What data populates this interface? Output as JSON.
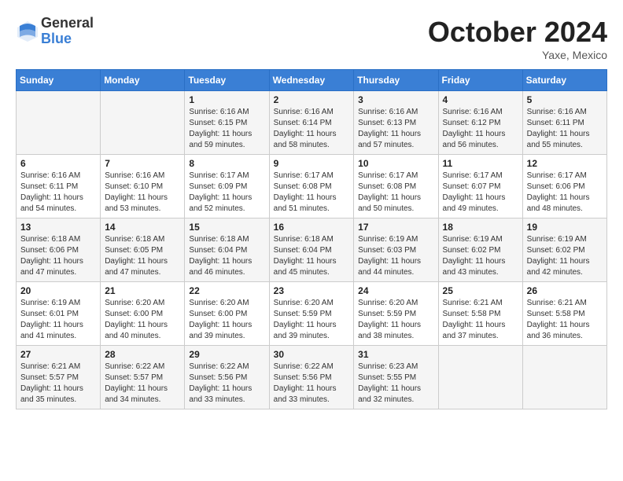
{
  "header": {
    "logo_general": "General",
    "logo_blue": "Blue",
    "month_title": "October 2024",
    "location": "Yaxe, Mexico"
  },
  "days_of_week": [
    "Sunday",
    "Monday",
    "Tuesday",
    "Wednesday",
    "Thursday",
    "Friday",
    "Saturday"
  ],
  "weeks": [
    [
      {
        "day": "",
        "info": ""
      },
      {
        "day": "",
        "info": ""
      },
      {
        "day": "1",
        "info": "Sunrise: 6:16 AM\nSunset: 6:15 PM\nDaylight: 11 hours and 59 minutes."
      },
      {
        "day": "2",
        "info": "Sunrise: 6:16 AM\nSunset: 6:14 PM\nDaylight: 11 hours and 58 minutes."
      },
      {
        "day": "3",
        "info": "Sunrise: 6:16 AM\nSunset: 6:13 PM\nDaylight: 11 hours and 57 minutes."
      },
      {
        "day": "4",
        "info": "Sunrise: 6:16 AM\nSunset: 6:12 PM\nDaylight: 11 hours and 56 minutes."
      },
      {
        "day": "5",
        "info": "Sunrise: 6:16 AM\nSunset: 6:11 PM\nDaylight: 11 hours and 55 minutes."
      }
    ],
    [
      {
        "day": "6",
        "info": "Sunrise: 6:16 AM\nSunset: 6:11 PM\nDaylight: 11 hours and 54 minutes."
      },
      {
        "day": "7",
        "info": "Sunrise: 6:16 AM\nSunset: 6:10 PM\nDaylight: 11 hours and 53 minutes."
      },
      {
        "day": "8",
        "info": "Sunrise: 6:17 AM\nSunset: 6:09 PM\nDaylight: 11 hours and 52 minutes."
      },
      {
        "day": "9",
        "info": "Sunrise: 6:17 AM\nSunset: 6:08 PM\nDaylight: 11 hours and 51 minutes."
      },
      {
        "day": "10",
        "info": "Sunrise: 6:17 AM\nSunset: 6:08 PM\nDaylight: 11 hours and 50 minutes."
      },
      {
        "day": "11",
        "info": "Sunrise: 6:17 AM\nSunset: 6:07 PM\nDaylight: 11 hours and 49 minutes."
      },
      {
        "day": "12",
        "info": "Sunrise: 6:17 AM\nSunset: 6:06 PM\nDaylight: 11 hours and 48 minutes."
      }
    ],
    [
      {
        "day": "13",
        "info": "Sunrise: 6:18 AM\nSunset: 6:06 PM\nDaylight: 11 hours and 47 minutes."
      },
      {
        "day": "14",
        "info": "Sunrise: 6:18 AM\nSunset: 6:05 PM\nDaylight: 11 hours and 47 minutes."
      },
      {
        "day": "15",
        "info": "Sunrise: 6:18 AM\nSunset: 6:04 PM\nDaylight: 11 hours and 46 minutes."
      },
      {
        "day": "16",
        "info": "Sunrise: 6:18 AM\nSunset: 6:04 PM\nDaylight: 11 hours and 45 minutes."
      },
      {
        "day": "17",
        "info": "Sunrise: 6:19 AM\nSunset: 6:03 PM\nDaylight: 11 hours and 44 minutes."
      },
      {
        "day": "18",
        "info": "Sunrise: 6:19 AM\nSunset: 6:02 PM\nDaylight: 11 hours and 43 minutes."
      },
      {
        "day": "19",
        "info": "Sunrise: 6:19 AM\nSunset: 6:02 PM\nDaylight: 11 hours and 42 minutes."
      }
    ],
    [
      {
        "day": "20",
        "info": "Sunrise: 6:19 AM\nSunset: 6:01 PM\nDaylight: 11 hours and 41 minutes."
      },
      {
        "day": "21",
        "info": "Sunrise: 6:20 AM\nSunset: 6:00 PM\nDaylight: 11 hours and 40 minutes."
      },
      {
        "day": "22",
        "info": "Sunrise: 6:20 AM\nSunset: 6:00 PM\nDaylight: 11 hours and 39 minutes."
      },
      {
        "day": "23",
        "info": "Sunrise: 6:20 AM\nSunset: 5:59 PM\nDaylight: 11 hours and 39 minutes."
      },
      {
        "day": "24",
        "info": "Sunrise: 6:20 AM\nSunset: 5:59 PM\nDaylight: 11 hours and 38 minutes."
      },
      {
        "day": "25",
        "info": "Sunrise: 6:21 AM\nSunset: 5:58 PM\nDaylight: 11 hours and 37 minutes."
      },
      {
        "day": "26",
        "info": "Sunrise: 6:21 AM\nSunset: 5:58 PM\nDaylight: 11 hours and 36 minutes."
      }
    ],
    [
      {
        "day": "27",
        "info": "Sunrise: 6:21 AM\nSunset: 5:57 PM\nDaylight: 11 hours and 35 minutes."
      },
      {
        "day": "28",
        "info": "Sunrise: 6:22 AM\nSunset: 5:57 PM\nDaylight: 11 hours and 34 minutes."
      },
      {
        "day": "29",
        "info": "Sunrise: 6:22 AM\nSunset: 5:56 PM\nDaylight: 11 hours and 33 minutes."
      },
      {
        "day": "30",
        "info": "Sunrise: 6:22 AM\nSunset: 5:56 PM\nDaylight: 11 hours and 33 minutes."
      },
      {
        "day": "31",
        "info": "Sunrise: 6:23 AM\nSunset: 5:55 PM\nDaylight: 11 hours and 32 minutes."
      },
      {
        "day": "",
        "info": ""
      },
      {
        "day": "",
        "info": ""
      }
    ]
  ]
}
